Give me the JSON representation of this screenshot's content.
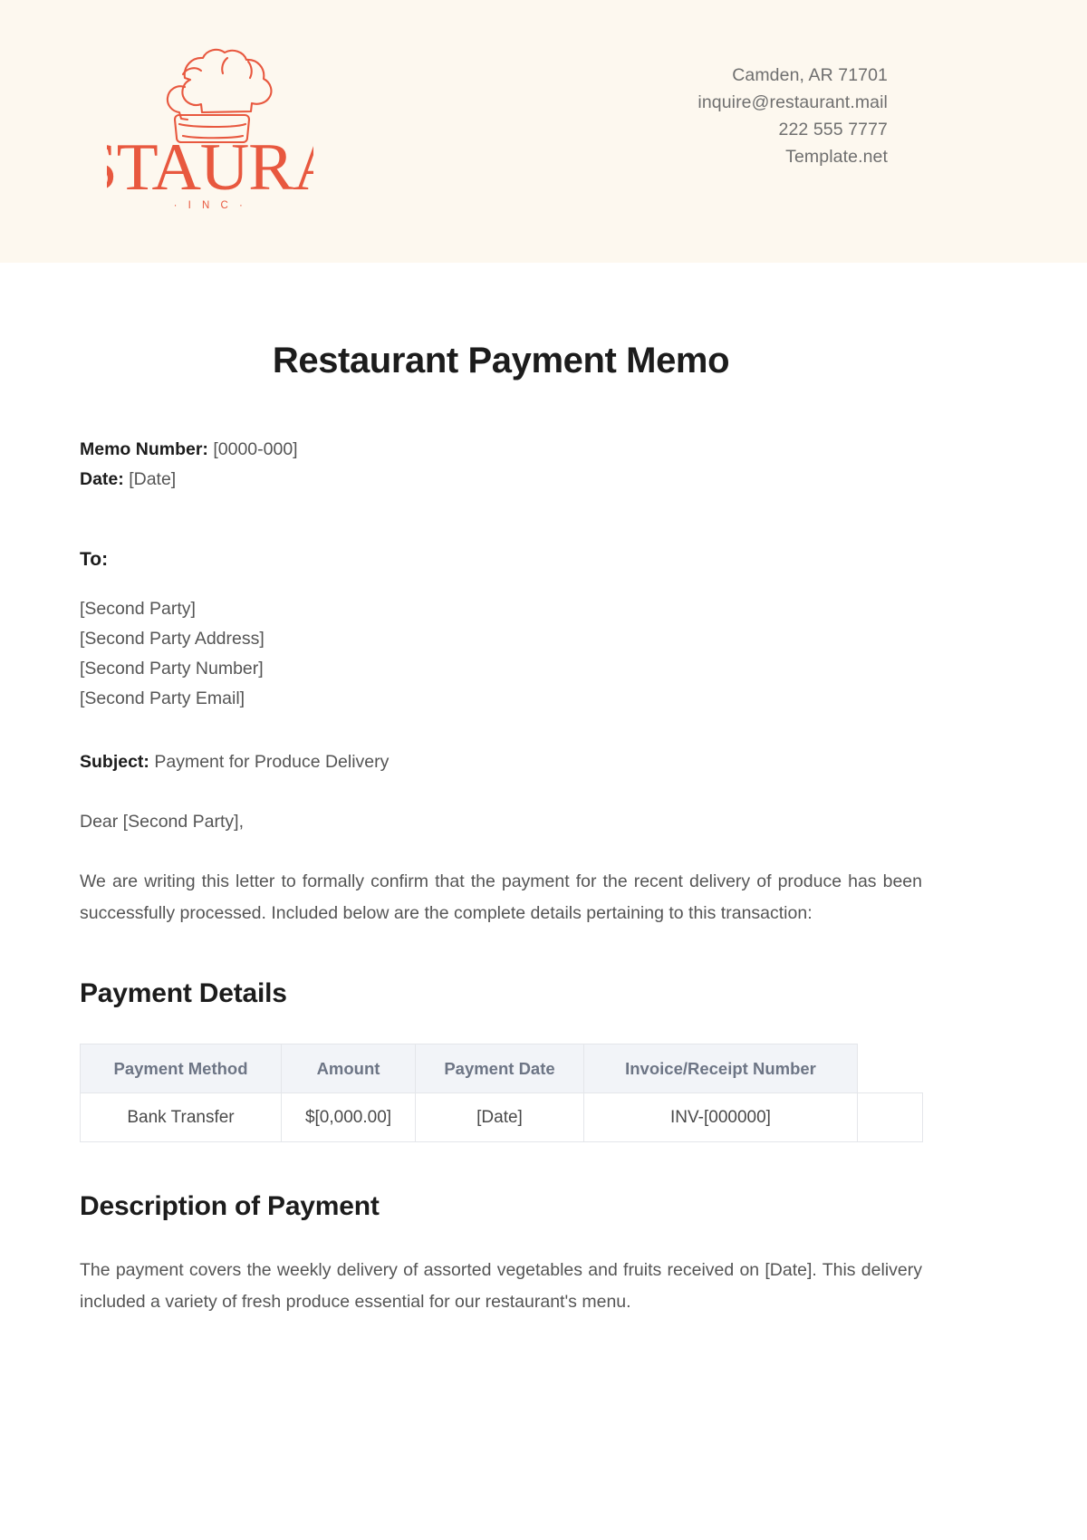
{
  "header": {
    "logo": {
      "brand_name": "RESTAURANT",
      "brand_suffix": "· I N C ·",
      "icon": "chef-hat-icon",
      "color": "#e8583f",
      "background": "#fdf8ef"
    },
    "contact": [
      "Camden, AR 71701",
      "inquire@restaurant.mail",
      "222 555 7777",
      "Template.net"
    ]
  },
  "document": {
    "title": "Restaurant Payment Memo",
    "meta": {
      "memo_number_label": "Memo Number:",
      "memo_number_value": "[0000-000]",
      "date_label": "Date:",
      "date_value": "[Date]"
    },
    "recipient": {
      "heading": "To:",
      "lines": [
        "[Second Party]",
        "[Second Party Address]",
        "[Second Party Number]",
        "[Second Party Email]"
      ]
    },
    "subject": {
      "label": "Subject:",
      "value": "Payment for Produce Delivery"
    },
    "salutation": "Dear [Second Party],",
    "intro_paragraph": "We are writing this letter to formally confirm that the payment for the recent delivery of produce has been successfully processed. Included below are the complete details pertaining to this transaction:",
    "payment_details": {
      "heading": "Payment Details",
      "columns": [
        "Payment Method",
        "Amount",
        "Payment Date",
        "Invoice/Receipt Number"
      ],
      "rows": [
        {
          "method": "Bank Transfer",
          "amount": "$[0,000.00]",
          "payment_date": "[Date]",
          "invoice_number": "INV-[000000]"
        }
      ]
    },
    "description": {
      "heading": "Description of Payment",
      "paragraph": "The payment covers the weekly delivery of assorted vegetables and fruits received on [Date]. This delivery included a variety of fresh produce essential for our restaurant's menu."
    }
  }
}
